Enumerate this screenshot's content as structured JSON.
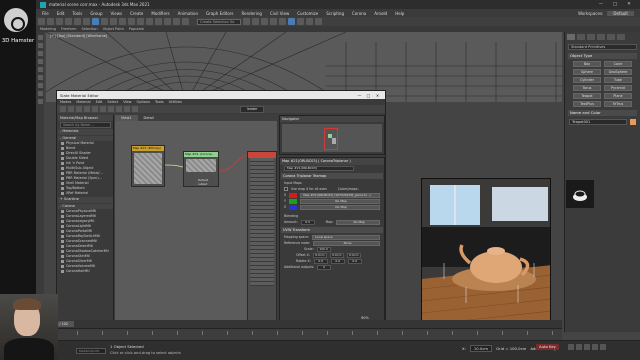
{
  "channel": {
    "name": "3D Hamster"
  },
  "window": {
    "title": "material scene corr.max - Autodesk 3ds Max 2021",
    "controls": [
      "—",
      "□",
      "✕"
    ]
  },
  "menu": {
    "items": [
      "File",
      "Edit",
      "Tools",
      "Group",
      "Views",
      "Create",
      "Modifiers",
      "Animation",
      "Graph Editors",
      "Rendering",
      "Civil View",
      "Customize",
      "Scripting",
      "Corona",
      "Arnold",
      "Help"
    ],
    "workspace_label": "Workspaces:",
    "workspace_value": "Default"
  },
  "toolbar": {
    "selection_set_placeholder": "Create Selection Se"
  },
  "ribbon": {
    "items": [
      "Modeling",
      "Freeform",
      "Selection",
      "Object Paint",
      "Populate"
    ]
  },
  "viewport_top": {
    "label": "[+] [Top] [Standard] [Wireframe]"
  },
  "command_panel": {
    "dropdown": "Standard Primitives",
    "object_type_header": "Object Type",
    "autogrid": "AutoGrid",
    "objects": [
      "Box",
      "Cone",
      "Sphere",
      "GeoSphere",
      "Cylinder",
      "Tube",
      "Torus",
      "Pyramid",
      "Teapot",
      "Plane",
      "TextPlus",
      "TeTrus"
    ],
    "name_color_header": "Name and Color",
    "name_value": "Teapot001",
    "color": "#e89a5c"
  },
  "slate": {
    "title": "Slate Material Editor",
    "window_controls": [
      "—",
      "□",
      "✕"
    ],
    "menu": [
      "Modes",
      "Material",
      "Edit",
      "Select",
      "View",
      "Options",
      "Tools",
      "Utilities"
    ],
    "view_selector": "leader",
    "browser": {
      "header": "Material/Map Browser",
      "search_placeholder": "Search by Name ...",
      "groups": [
        {
          "label": "- Materials",
          "items": []
        },
        {
          "label": "- General",
          "items": [
            "Physical Material",
            "Blend",
            "DirectX Shader",
            "Double Sided",
            "Ink 'n Paint",
            "Multi/Sub-Object",
            "PBR Material (Metal/...",
            "PBR Material (Spec)...",
            "Shell Material",
            "Top/Bottom",
            "XRef Material"
          ]
        },
        {
          "label": "+ Scanline",
          "items": []
        },
        {
          "label": "- Corona",
          "items": [
            "CoronaPhysicalMtl",
            "CoronaLayeredMtl",
            "CoronaLegacyMtl",
            "CoronaLightMtl",
            "CoronaPortalMtl",
            "CoronaRaySwitchMtl",
            "CoronaScannedMtl",
            "CoronaSelectMtl",
            "CoronaShadowCatcherMtl",
            "CoronaSkinMtl",
            "CoronaSlicerMtl",
            "CoronaVolumeMtl",
            "CoronaHairMtl"
          ]
        }
      ]
    },
    "view_tabs": [
      "View1",
      "Detail"
    ],
    "nodes": [
      {
        "label": "Map #21 (Bitmap)",
        "sub": "Bitmap",
        "color": "#c9a030"
      },
      {
        "label": "Map #21 (Corona...",
        "sub": "Corona Tri...",
        "color": "#8fd18f"
      }
    ],
    "node_output": "Default output",
    "navigator_header": "Navigator",
    "param_header": "Map #21(ORLBC03) ( CoronaTriplanar )",
    "map_name": "Map #21(ORLBC03)",
    "rollout_triplanar": "Corona Triplanar Texmap",
    "input_maps_label": "Input Maps",
    "use_map_x": "Use map X for all axes",
    "colors_maps_label": "Colors/maps:",
    "maps": [
      {
        "axis": "X",
        "color": "#d81a1a",
        "value": "Map #21(ORLBC03) (16702620M_giulia-bl...)"
      },
      {
        "axis": "Y",
        "color": "#19a31c",
        "value": "No Map"
      },
      {
        "axis": "Z",
        "color": "#2535d6",
        "value": "No Map"
      }
    ],
    "blending_label": "Blending",
    "amount_label": "Amount:",
    "amount_value": "0.5",
    "map_label": "Map:",
    "blend_map_value": "No Map",
    "uvw_label": "UVW Transform",
    "mapping_space_label": "Mapping space:",
    "mapping_space_value": "Local space",
    "reference_node_label": "Reference node:",
    "reference_node_value": "None",
    "scale_label": "Scale:",
    "scale_value": "100.0",
    "offset_label": "Offset X:",
    "offset_values": [
      "0.0cm",
      "0.0cm",
      "0.0cm"
    ],
    "rotate_label": "Rotate X:",
    "rotate_values": [
      "0.0",
      "0.0",
      "0.0"
    ],
    "additional_outputs_label": "Additional outputs:",
    "additional_outputs_value": "0",
    "zoom_value": "90%"
  },
  "render_frame": {
    "background": "#1e1e1e"
  },
  "timeline": {
    "slider": "0 / 100"
  },
  "status": {
    "selection": "1 Object Selected",
    "hint": "Click or click-and-drag to select objects",
    "x_label": "X:",
    "x_value": "10.0cm",
    "grid": "Grid = 100.0cm",
    "add_time_tag": "Add Time Tag",
    "auto_key": "Auto Key",
    "maxscript": "MAXScript Mi."
  }
}
